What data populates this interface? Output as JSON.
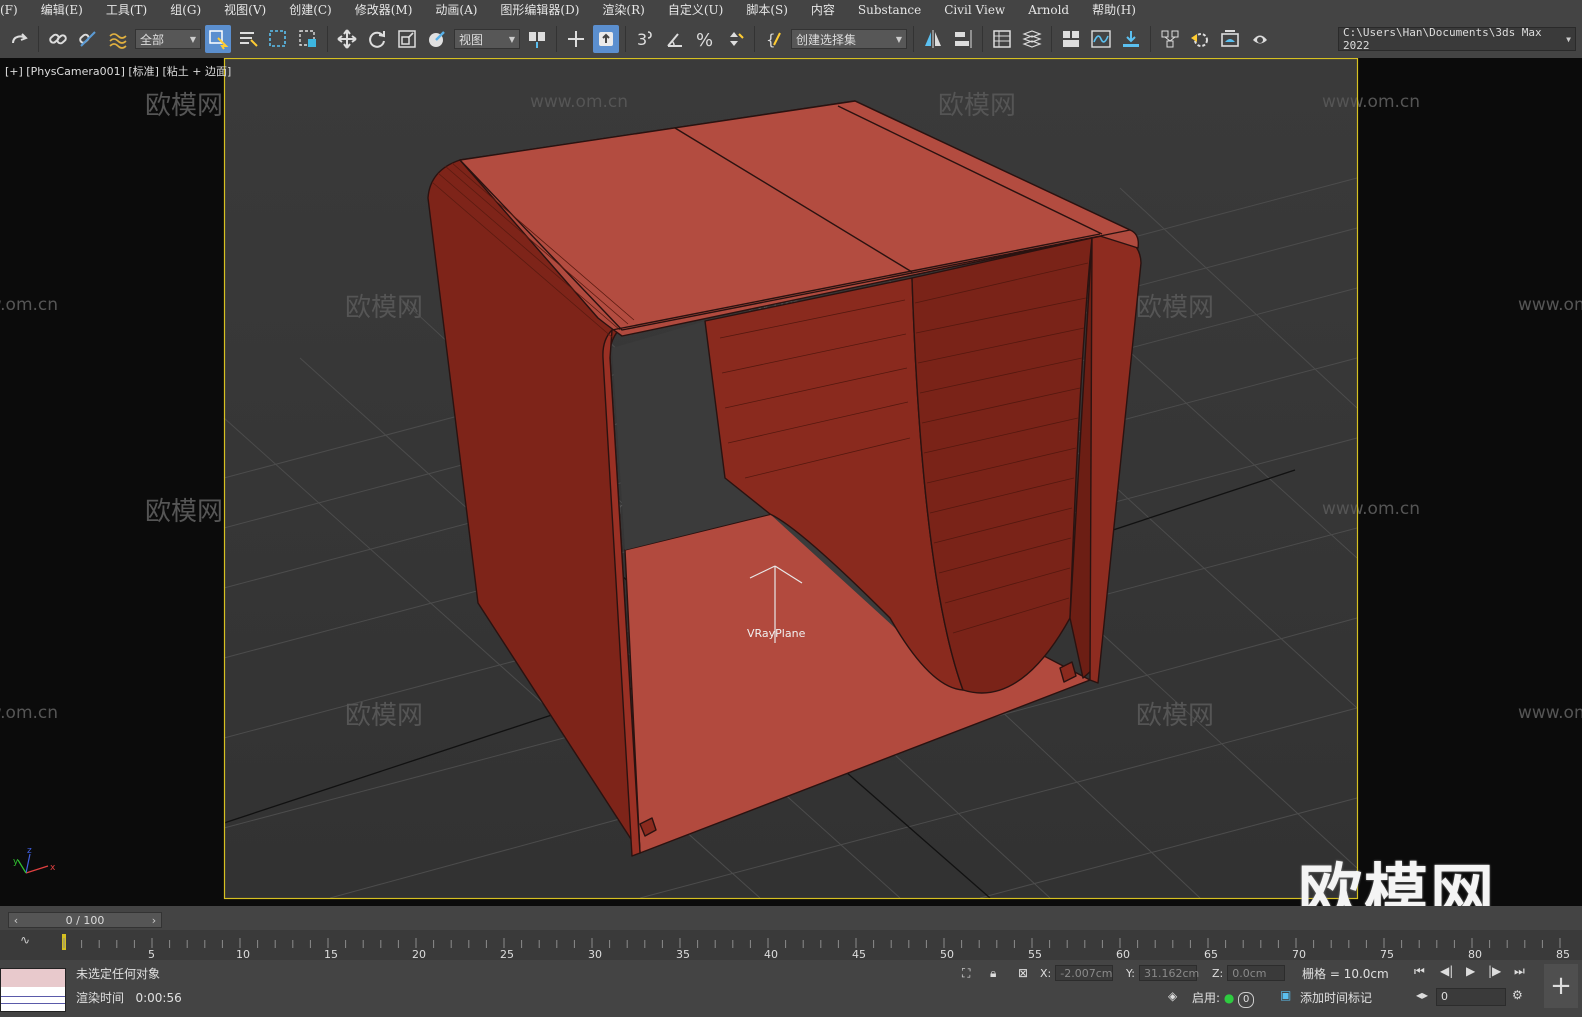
{
  "menu": [
    "(F)",
    "编辑(E)",
    "工具(T)",
    "组(G)",
    "视图(V)",
    "创建(C)",
    "修改器(M)",
    "动画(A)",
    "图形编辑器(D)",
    "渲染(R)",
    "自定义(U)",
    "脚本(S)",
    "内容",
    "Substance",
    "Civil View",
    "Arnold",
    "帮助(H)"
  ],
  "toolbar": {
    "selection_filter": "全部",
    "reference_coord": "视图",
    "named_selection": "创建选择集",
    "project_path": "C:\\Users\\Han\\Documents\\3ds Max 2022"
  },
  "viewport": {
    "label": "[+] [PhysCamera001] [标准] [粘土 + 边面]",
    "object_label": "VRayPlane",
    "watermark_text": "欧模网",
    "watermark_url": "www.om.cn",
    "logo_watermark": "欧模网",
    "object_color": "#b0493d",
    "frame_color": "#d6c021"
  },
  "timeline": {
    "slider_label": "0 / 100",
    "ticks": [
      "5",
      "10",
      "15",
      "20",
      "25",
      "30",
      "35",
      "40",
      "45",
      "50",
      "55",
      "60",
      "65",
      "70",
      "75",
      "80",
      "85"
    ]
  },
  "status": {
    "message": "未选定任何对象",
    "render_time_label": "渲染时间",
    "render_time_value": "0:00:56",
    "x_label": "X:",
    "x_value": "-2.007cm",
    "y_label": "Y:",
    "y_value": "31.162cm",
    "z_label": "Z:",
    "z_value": "0.0cm",
    "grid": "栅格 = 10.0cm",
    "enable_label": "启用:",
    "enable_count": "0",
    "add_time_tag": "添加时间标记",
    "frame_value": "0"
  }
}
